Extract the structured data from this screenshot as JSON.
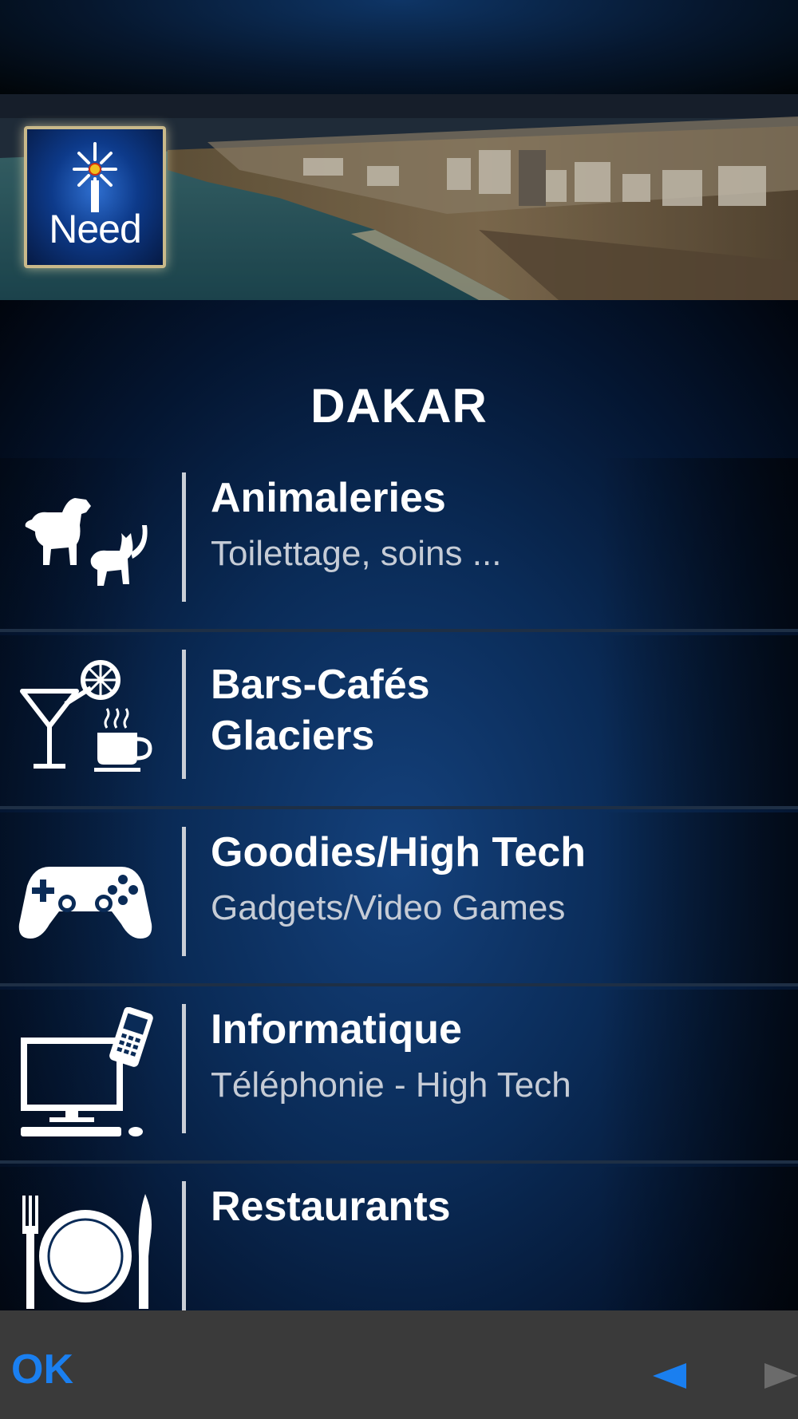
{
  "header": {
    "logo_text": "Need"
  },
  "city": {
    "title": "DAKAR"
  },
  "categories": [
    {
      "title": "Animaleries",
      "subtitle": "Toilettage, soins ...",
      "icon": "pets-icon"
    },
    {
      "title": "Bars-Cafés\nGlaciers",
      "subtitle": "",
      "icon": "cocktail-coffee-icon"
    },
    {
      "title": "Goodies/High Tech",
      "subtitle": "Gadgets/Video Games",
      "icon": "gamepad-icon"
    },
    {
      "title": "Informatique",
      "subtitle": "Téléphonie - High Tech",
      "icon": "computer-phone-icon"
    },
    {
      "title": "Restaurants",
      "subtitle": "",
      "icon": "plate-cutlery-icon"
    }
  ],
  "toolbar": {
    "ok_label": "OK",
    "back_icon": "left-arrow-icon",
    "forward_icon": "right-arrow-icon"
  },
  "colors": {
    "accent_blue": "#1a7ff0",
    "toolbar_bg": "#3a3a3a",
    "disabled_arrow": "#6b6b6b"
  }
}
